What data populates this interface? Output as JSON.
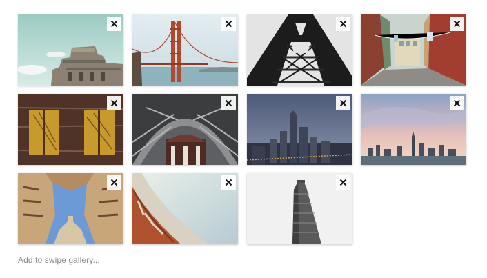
{
  "gallery": {
    "tiles": [
      {
        "subject": "concrete building top under pale sky",
        "remove_icon": "close-icon"
      },
      {
        "subject": "golden gate bridge",
        "remove_icon": "close-icon"
      },
      {
        "subject": "steel tower structure from below",
        "remove_icon": "close-icon"
      },
      {
        "subject": "colorful old town street",
        "remove_icon": "close-icon"
      },
      {
        "subject": "weathered brick wall with yellow panels",
        "remove_icon": "close-icon"
      },
      {
        "subject": "arched ceiling of station",
        "remove_icon": "close-icon"
      },
      {
        "subject": "city skyscrapers at dusk",
        "remove_icon": "close-icon"
      },
      {
        "subject": "city skyline at sunset",
        "remove_icon": "close-icon"
      },
      {
        "subject": "looking up between buildings",
        "remove_icon": "close-icon"
      },
      {
        "subject": "curved building facade",
        "remove_icon": "close-icon"
      },
      {
        "subject": "flatiron building",
        "remove_icon": "close-icon"
      }
    ],
    "add_label": "Add to swipe gallery..."
  }
}
